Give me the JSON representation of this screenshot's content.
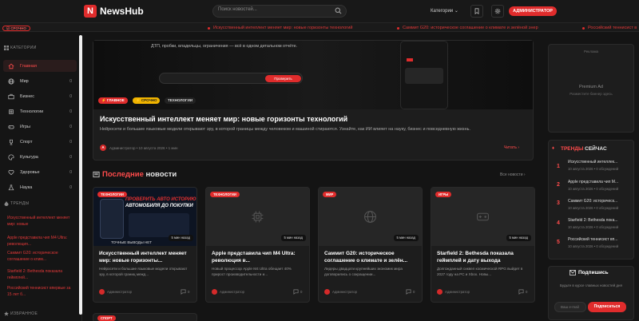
{
  "header": {
    "logo_letter": "N",
    "brand": "NewsHub",
    "search_placeholder": "Поиск новостей...",
    "categories_label": "Категории",
    "admin_label": "АДМИНИСТРАТОР"
  },
  "ticker": {
    "badge": "СРОЧНО",
    "items": [
      "Искусственный интеллект меняет мир: новые горизонты технологий",
      "Саммит G20: историческое соглашение о климате и зелёной энер",
      "Российский теннисист в"
    ]
  },
  "sidebar": {
    "categories_heading": "КАТЕГОРИИ",
    "items": [
      {
        "label": "Главная",
        "count": "",
        "icon": "home-icon",
        "active": true
      },
      {
        "label": "Мир",
        "count": "0",
        "icon": "globe-icon"
      },
      {
        "label": "Бизнес",
        "count": "0",
        "icon": "briefcase-icon"
      },
      {
        "label": "Технологии",
        "count": "0",
        "icon": "cpu-icon"
      },
      {
        "label": "Игры",
        "count": "0",
        "icon": "gamepad-icon"
      },
      {
        "label": "Спорт",
        "count": "0",
        "icon": "trophy-icon"
      },
      {
        "label": "Культура",
        "count": "0",
        "icon": "palette-icon"
      },
      {
        "label": "Здоровье",
        "count": "0",
        "icon": "heart-icon"
      },
      {
        "label": "Наука",
        "count": "0",
        "icon": "flask-icon"
      }
    ],
    "trends_heading": "ТРЕНДЫ",
    "trends": [
      {
        "title": "Искусственный интеллект меняет мир: новые",
        "meta": ""
      },
      {
        "title": "Apple представила чип M4 Ultra: революция...",
        "meta": ""
      },
      {
        "title": "Саммит G20: историческое соглашение о клим...",
        "meta": ""
      },
      {
        "title": "Starfield 2: Bethesda показала геймплей...",
        "meta": ""
      },
      {
        "title": "Российский теннисист впервые за 15 лет б...",
        "meta": ""
      }
    ],
    "favorites_heading": "ИЗБРАННОЕ"
  },
  "hero": {
    "preview_text": "ДТП, пробки, владельцы, ограничения — всё в одном детальном отчёте.",
    "preview_button": "Проверить",
    "tags": [
      "ГЛАВНОЕ",
      "СРОЧНО",
      "ТЕХНОЛОГИИ"
    ],
    "title": "Искусственный интеллект меняет мир: новые горизонты технологий",
    "description": "Нейросети и большие языковые модели открывают эру, в которой границы между человеком и машиной стираются. Узнайте, как ИИ влияет на науку, бизнес и повседневную жизнь.",
    "author_initial": "А",
    "author": "Администратор",
    "date": "10 августа 2026",
    "read_time": "1 мин",
    "read_more": "Читать"
  },
  "latest": {
    "heading_accent": "Последние",
    "heading_rest": "новости",
    "all_link": "Все новости"
  },
  "cards": [
    {
      "tag": "ТЕХНОЛОГИИ",
      "time": "5 мин назад",
      "icon": "image-icon",
      "title": "Искусственный интеллект меняет мир: новые горизонты...",
      "desc": "Нейросети и большие языковые модели открывают эру, в которой границ межд...",
      "author": "Администратор",
      "comments": "0",
      "promo_line1": "ПРОВЕРИТЬ АВТО ИСТОРИЮ",
      "promo_line2": "АВТОМОБИЛЯ ДО ПОКУПКИ",
      "promo_bottom": "ТОЧНЫЕ ВЫВОДЫ НЕТ"
    },
    {
      "tag": "ТЕХНОЛОГИИ",
      "time": "5 мин назад",
      "icon": "cpu-icon",
      "title": "Apple представила чип M4 Ultra: революция в...",
      "desc": "Новый процессор Apple M4 Ultra обещает 40% прирост производительности и...",
      "author": "Администратор",
      "comments": "0"
    },
    {
      "tag": "МИР",
      "time": "5 мин назад",
      "icon": "globe-icon",
      "title": "Саммит G20: историческое соглашение о климате и зелён...",
      "desc": "Лидеры двадцати крупнейших экономик мира договорились о сокращении...",
      "author": "Администратор",
      "comments": "0"
    },
    {
      "tag": "ИГРЫ",
      "time": "5 мин назад",
      "icon": "gamepad-icon",
      "title": "Starfield 2: Bethesda показала геймплей и дату выхода",
      "desc": "Долгожданный сиквел космической RPG выйдет в 2027 году на PC и Xbox. Новы...",
      "author": "Администратор",
      "comments": "0"
    }
  ],
  "card5_tag": "СПОРТ",
  "right": {
    "ad_label": "Реклама",
    "ad_title": "Premium Ad",
    "ad_sub": "Разместите баннер здесь",
    "trends_accent": "ТРЕНДЫ",
    "trends_rest": "СЕЙЧАС",
    "trends": [
      {
        "n": "1",
        "title": "Искусственный интеллек...",
        "meta": "10 августа 2026 • 0 обсуждений"
      },
      {
        "n": "2",
        "title": "Apple представила чип M...",
        "meta": "10 августа 2026 • 0 обсуждений"
      },
      {
        "n": "3",
        "title": "Саммит G20: историческ...",
        "meta": "10 августа 2026 • 0 обсуждений"
      },
      {
        "n": "4",
        "title": "Starfield 2: Bethesda пока...",
        "meta": "10 августа 2026 • 0 обсуждений"
      },
      {
        "n": "5",
        "title": "Российский теннисист вп...",
        "meta": "10 августа 2026 • 0 обсуждений"
      }
    ],
    "subscribe_title": "Подпишись",
    "subscribe_desc": "Будьте в курсе главных новостей дня",
    "email_placeholder": "Ваш e-mail",
    "subscribe_button": "Подписаться"
  },
  "colors": {
    "accent": "#e02c2c",
    "background": "#141414",
    "card": "#1d1d1d"
  }
}
